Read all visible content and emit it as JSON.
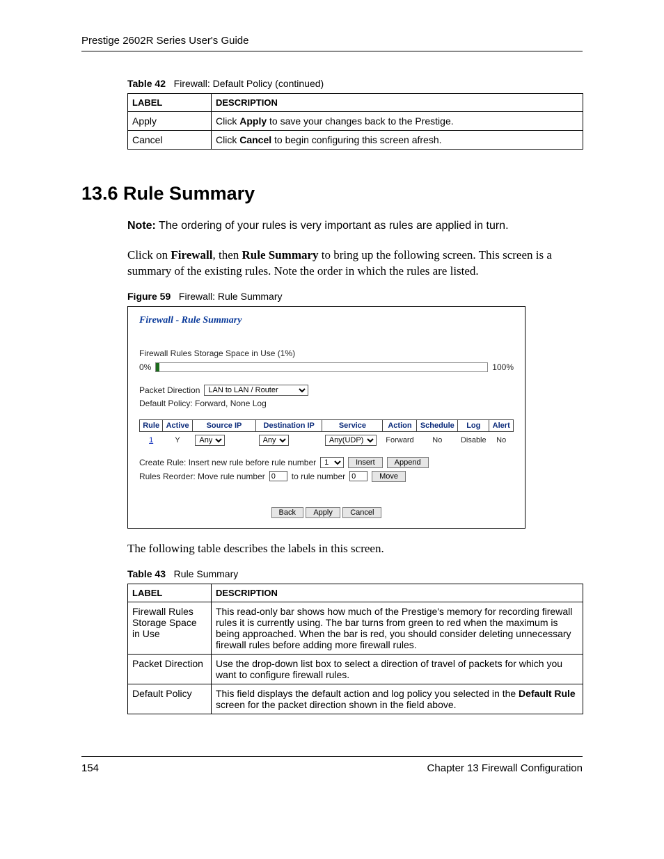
{
  "header": {
    "title": "Prestige 2602R Series User's Guide"
  },
  "table42": {
    "caption_bold": "Table 42",
    "caption_rest": "Firewall: Default Policy (continued)",
    "head_label": "LABEL",
    "head_desc": "DESCRIPTION",
    "rows": [
      {
        "label": "Apply",
        "pre": "Click ",
        "bold": "Apply",
        "post": " to save your changes back to the Prestige."
      },
      {
        "label": "Cancel",
        "pre": "Click ",
        "bold": "Cancel",
        "post": " to begin configuring this screen afresh."
      }
    ]
  },
  "section": {
    "heading": "13.6  Rule Summary",
    "note_bold": "Note:",
    "note_rest": " The ordering of your rules is very important as rules are applied in turn.",
    "para_pre": "Click on ",
    "para_b1": "Firewall",
    "para_mid1": ", then ",
    "para_b2": "Rule Summary",
    "para_mid2": " to bring up the following screen. This screen is a summary of the existing rules. Note the order in which the rules are listed."
  },
  "figure59": {
    "caption_bold": "Figure 59",
    "caption_rest": "Firewall: Rule Summary",
    "title": "Firewall - Rule Summary",
    "storage_label": "Firewall Rules Storage Space in Use  (1%)",
    "bar_left": "0%",
    "bar_right": "100%",
    "packet_dir_label": "Packet Direction",
    "packet_dir_value": "LAN to LAN / Router",
    "default_policy_text": "Default Policy: Forward, None Log",
    "rules_headers": [
      "Rule",
      "Active",
      "Source IP",
      "Destination IP",
      "Service",
      "Action",
      "Schedule",
      "Log",
      "Alert"
    ],
    "rules_row": {
      "rule": "1",
      "active": "Y",
      "source_ip": "Any",
      "dest_ip": "Any",
      "service": "Any(UDP)",
      "action": "Forward",
      "schedule": "No",
      "log": "Disable",
      "alert": "No"
    },
    "create_rule_label": "Create Rule: Insert new rule before rule number",
    "create_rule_value": "1",
    "insert_btn": "Insert",
    "append_btn": "Append",
    "reorder_label": "Rules Reorder: Move rule number",
    "reorder_from": "0",
    "reorder_mid": "to rule number",
    "reorder_to": "0",
    "move_btn": "Move",
    "back_btn": "Back",
    "apply_btn": "Apply",
    "cancel_btn": "Cancel"
  },
  "after_figure_para": "The following table describes the labels in this screen.",
  "table43": {
    "caption_bold": "Table 43",
    "caption_rest": "Rule Summary",
    "head_label": "LABEL",
    "head_desc": "DESCRIPTION",
    "rows": [
      {
        "label": "Firewall Rules Storage Space in Use",
        "desc": "This read-only bar shows how much of the Prestige's memory for recording firewall rules it is currently using. The bar turns from green to red when the maximum is being approached. When the bar is red, you should consider deleting unnecessary firewall rules before adding more firewall rules."
      },
      {
        "label": "Packet Direction",
        "desc": "Use the drop-down list box to select a direction of travel of packets for which you want to configure firewall rules."
      },
      {
        "label": "Default Policy",
        "pre": "This field displays the default action and log policy you selected in the ",
        "bold": "Default Rule",
        "post": " screen for the packet direction shown in the field above."
      }
    ]
  },
  "footer": {
    "page": "154",
    "chapter": "Chapter 13 Firewall Configuration"
  }
}
